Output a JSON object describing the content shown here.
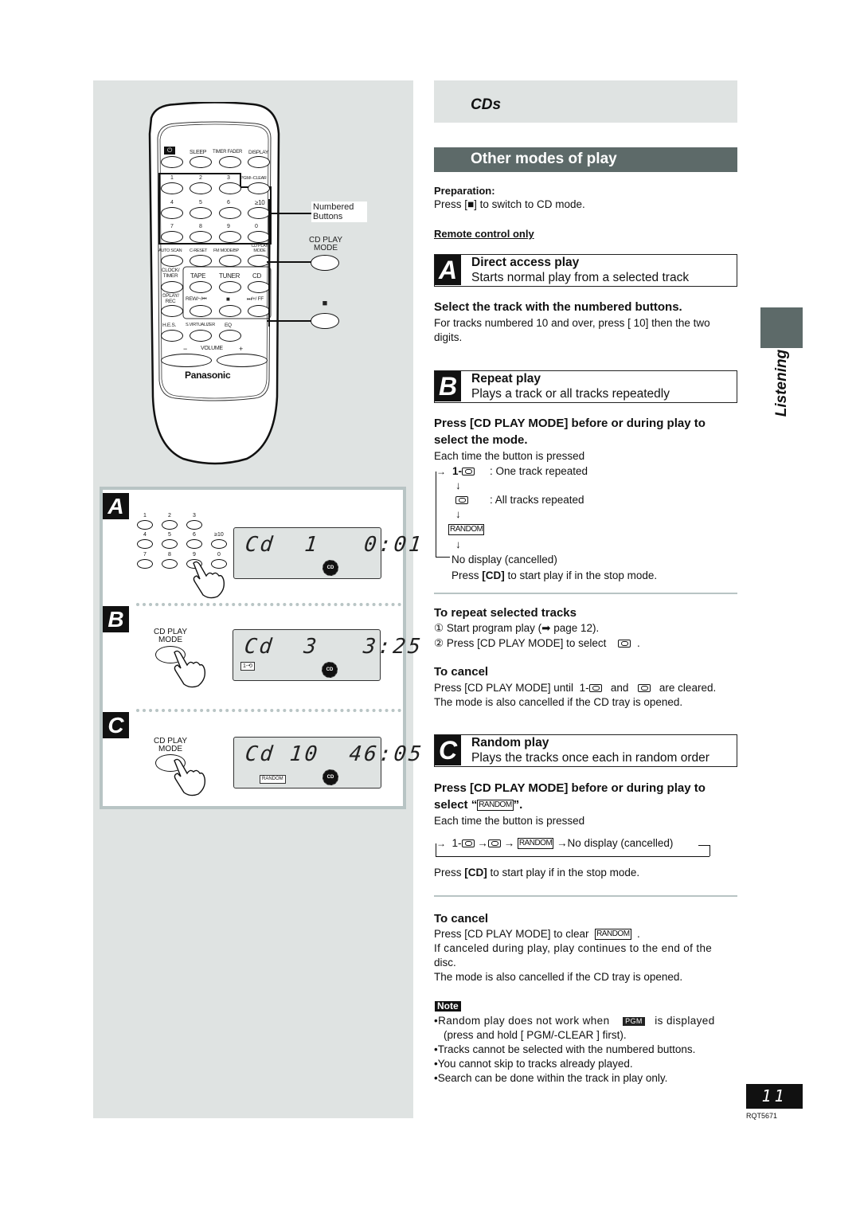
{
  "section_header": {
    "title": "CDs"
  },
  "bar": {
    "title": "Other modes of play"
  },
  "side_tab": {
    "label": "Listening"
  },
  "preparation": {
    "label": "Preparation:",
    "text_pre": "Press [",
    "stop_glyph": "■",
    "text_post": "] to switch to CD mode."
  },
  "remote_only": "Remote control only",
  "remote": {
    "brand": "Panasonic",
    "row0": [
      "⏻",
      "SLEEP",
      "TIMER FADER",
      "DISPLAY"
    ],
    "row1": [
      "1",
      "2",
      "3",
      "PGM/−CLEAR"
    ],
    "row2": [
      "4",
      "5",
      "6",
      "≥10"
    ],
    "row3": [
      "7",
      "8",
      "9",
      "0"
    ],
    "row4": [
      "AUTO SCAN",
      "C-RESET",
      "FM MODE/BP",
      "CD PLAY MODE"
    ],
    "row5": [
      "CLOCK/ TIMER",
      "TAPE",
      "TUNER",
      "CD"
    ],
    "row6": [
      "⏲PLAY/ REC",
      "REW/−/⏮",
      "■",
      "⏭/+/ FF"
    ],
    "row7": [
      "H.E.S.",
      "S.VIRTUALIZER",
      "EQ"
    ],
    "volume": {
      "minus": "−",
      "label": "VOLUME",
      "plus": "+"
    },
    "callouts": {
      "numbered": "Numbered Buttons",
      "cd_play_mode": "CD PLAY MODE",
      "stop": "■"
    }
  },
  "illustrations": {
    "a": {
      "letter": "A",
      "keys": [
        "1",
        "2",
        "3",
        "4",
        "5",
        "6",
        "≥10",
        "7",
        "8",
        "9",
        "0"
      ],
      "lcd": "Cd  1   0:01",
      "cd_badge": "CD"
    },
    "b": {
      "letter": "B",
      "button_label": "CD PLAY MODE",
      "lcd": "Cd  3   3:25",
      "indicator": "1-⟲",
      "cd_badge": "CD"
    },
    "c": {
      "letter": "C",
      "button_label": "CD PLAY MODE",
      "lcd": "Cd 10  46:05",
      "indicator": "RANDOM",
      "cd_badge": "CD"
    }
  },
  "section_a": {
    "letter": "A",
    "title": "Direct access play",
    "subtitle": "Starts normal play from a selected track",
    "instruction": "Select the track with the numbered buttons.",
    "detail_line1": "For tracks numbered 10 and over, press [  10] then the two",
    "detail_line2": "digits."
  },
  "section_b": {
    "letter": "B",
    "title": "Repeat play",
    "subtitle": "Plays a track or all tracks repeatedly",
    "instruction_line1": "Press [CD PLAY MODE] before or during play to",
    "instruction_line2": "select the mode.",
    "each_time": "Each time the button is pressed",
    "modes": [
      {
        "icon": "1-repeat",
        "prefix": "1-",
        "desc": ": One track repeated"
      },
      {
        "icon": "repeat",
        "prefix": "",
        "desc": ": All tracks repeated"
      },
      {
        "icon": "random",
        "label": "RANDOM",
        "desc": ""
      }
    ],
    "no_display": "No display (cancelled)",
    "press_cd_pre": "Press ",
    "press_cd_key": "[CD]",
    "press_cd_post": " to start play if in the stop mode.",
    "repeat_selected": {
      "heading": "To repeat selected tracks",
      "steps": [
        {
          "num": "①",
          "text": "Start program play (➡ page 12)."
        },
        {
          "num": "②",
          "text": "Press [CD PLAY MODE] to select",
          "trail": "."
        }
      ]
    },
    "cancel": {
      "heading": "To cancel",
      "line1_pre": "Press [CD PLAY MODE] until",
      "line1_mid1": "1-",
      "line1_and": "and",
      "line1_post": "are cleared.",
      "line2": "The mode is also cancelled if the CD tray is opened."
    }
  },
  "section_c": {
    "letter": "C",
    "title": "Random play",
    "subtitle": "Plays the tracks once each in random order",
    "instruction_line1": "Press [CD PLAY MODE] before or during play to",
    "instruction_line2_pre": "select “",
    "instruction_line2_box": "RANDOM",
    "instruction_line2_post": "”.",
    "each_time": "Each time the button is pressed",
    "flow": {
      "step1": "1-",
      "arrow": "→",
      "random": "RANDOM",
      "last": "No display (cancelled)"
    },
    "press_cd_pre": "Press ",
    "press_cd_key": "[CD]",
    "press_cd_post": " to start play if in the stop mode.",
    "cancel": {
      "heading": "To cancel",
      "line1_pre": "Press [CD PLAY MODE] to clear",
      "line1_box": "RANDOM",
      "line1_post": ".",
      "line2": "If canceled during play, play continues to the end of the",
      "line3": "disc.",
      "line4": "The mode is also cancelled if the CD tray is opened."
    }
  },
  "note": {
    "label": "Note",
    "items": [
      {
        "pre": "•Random play does not work when",
        "box": "PGM",
        "post": "is displayed"
      },
      {
        "text": "(press and hold [ PGM/-CLEAR ] first)."
      },
      {
        "text": "•Tracks cannot be selected with the numbered buttons."
      },
      {
        "text": "•You cannot skip to tracks already played."
      },
      {
        "text": "•Search can be done within the track in play only."
      }
    ]
  },
  "footer": {
    "page_number": "11",
    "doc_code": "RQT5671"
  }
}
